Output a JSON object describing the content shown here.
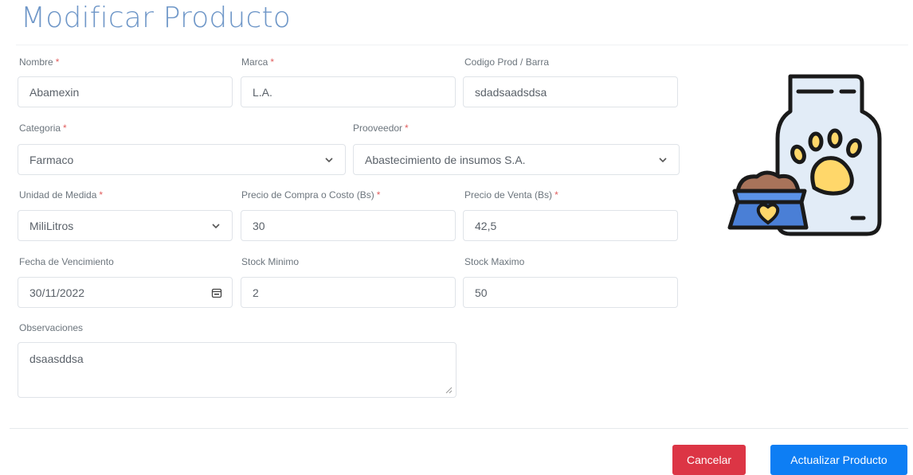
{
  "page": {
    "title": "Modificar Producto"
  },
  "form": {
    "nombre": {
      "label": "Nombre",
      "required_mark": "*",
      "value": "Abamexin"
    },
    "marca": {
      "label": "Marca",
      "required_mark": "*",
      "value": "L.A."
    },
    "codigo": {
      "label": "Codigo Prod / Barra",
      "value": "sdadsaadsdsa"
    },
    "categoria": {
      "label": "Categoria",
      "required_mark": "*",
      "value": "Farmaco"
    },
    "proveedor": {
      "label": "Prooveedor",
      "required_mark": "*",
      "value": "Abastecimiento de insumos S.A."
    },
    "unidad": {
      "label": "Unidad de Medida",
      "required_mark": "*",
      "value": "MiliLitros"
    },
    "precio_compra": {
      "label": "Precio de Compra o Costo (Bs)",
      "required_mark": "*",
      "value": "30"
    },
    "precio_venta": {
      "label": "Precio de Venta (Bs)",
      "required_mark": "*",
      "value": "42,5"
    },
    "fecha_vencimiento": {
      "label": "Fecha de Vencimiento",
      "value": "30/11/2022"
    },
    "stock_minimo": {
      "label": "Stock Minimo",
      "value": "2"
    },
    "stock_maximo": {
      "label": "Stock Maximo",
      "value": "50"
    },
    "observaciones": {
      "label": "Observaciones",
      "value": "dsaasddsa"
    }
  },
  "actions": {
    "cancel_label": "Cancelar",
    "update_label": "Actualizar Producto"
  },
  "colors": {
    "title": "#6f97c8",
    "cancel": "#dc3545",
    "update": "#0d7ef4",
    "required": "#e15f5f"
  },
  "icons": {
    "select_arrow": "chevron-down-icon",
    "date_picker": "calendar-icon",
    "illustration": "pet-food-bag-icon"
  }
}
